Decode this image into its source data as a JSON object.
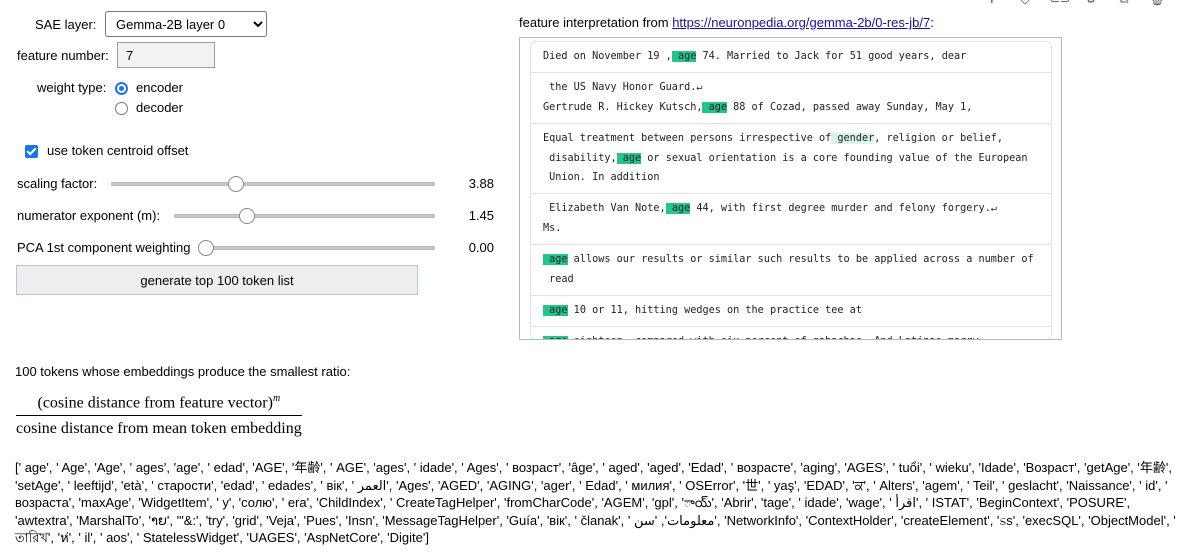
{
  "toolbar": {
    "icons": [
      "plus-icon",
      "diamond-icon",
      "link-icon",
      "gear-icon",
      "expand-icon",
      "trash-icon"
    ]
  },
  "controls": {
    "sae_layer_label": "SAE layer:",
    "sae_layer_value": "Gemma-2B layer 0",
    "feature_number_label": "feature number:",
    "feature_number_value": "7",
    "weight_type_label": "weight type:",
    "weight_options": [
      {
        "label": "encoder",
        "selected": true
      },
      {
        "label": "decoder",
        "selected": false
      }
    ],
    "centroid_label": "use token centroid offset",
    "centroid_checked": true,
    "sliders": [
      {
        "label": "scaling factor:",
        "value": "3.88",
        "fraction": 0.31
      },
      {
        "label": "numerator exponent (m):",
        "value": "1.45",
        "fraction": 0.28
      },
      {
        "label": "PCA 1st component weighting",
        "value": "0.00",
        "fraction": 0.0
      }
    ],
    "generate_button": "generate top 100 token list"
  },
  "interpretation": {
    "prefix": "feature interpretation from ",
    "link": "https://neuronpedia.org/gemma-2b/0-res-jb/7",
    "suffix": ":",
    "snippets": [
      {
        "parts": [
          {
            "t": "Died on November 19 ,"
          },
          {
            "t": " age",
            "h": 1
          },
          {
            "t": " 74. Married to Jack for 51 good years, dear"
          }
        ]
      },
      {
        "parts": [
          {
            "t": " the US Navy Honor Guard.↵\nGertrude R. Hickey Kutsch,"
          },
          {
            "t": " age",
            "h": 1
          },
          {
            "t": " 88 of Cozad, passed away Sunday, May 1,"
          }
        ]
      },
      {
        "parts": [
          {
            "t": "Equal treatment between persons irrespective of"
          },
          {
            "t": " gender",
            "h": 2
          },
          {
            "t": ", religion or belief,\n disability,"
          },
          {
            "t": " age",
            "h": 1
          },
          {
            "t": " or sexual orientation is a core founding value of the European\n Union. In addition"
          }
        ]
      },
      {
        "parts": [
          {
            "t": " Elizabeth Van Note,"
          },
          {
            "t": " age",
            "h": 1
          },
          {
            "t": " 44, with first degree murder and felony forgery.↵\nMs."
          }
        ]
      },
      {
        "parts": [
          {
            "t": " age",
            "h": 1
          },
          {
            "t": " allows our results or similar such results to be applied across a number of\n read"
          }
        ]
      },
      {
        "parts": [
          {
            "t": " age",
            "h": 1
          },
          {
            "t": " 10 or 11, hitting wedges on the practice tee at"
          }
        ]
      },
      {
        "parts": [
          {
            "t": " age",
            "h": 1
          },
          {
            "t": " eighteen, compared with six percent of gabachas. And Latinas marry"
          }
        ]
      }
    ]
  },
  "results": {
    "heading": "100 tokens whose embeddings produce the smallest ratio:",
    "formula_numerator": "(cosine distance from feature vector)",
    "formula_exponent": "m",
    "formula_denominator": "cosine distance from mean token embedding",
    "token_list": "[' age', ' Age', 'Age', ' ages', 'age', ' edad', 'AGE', '年齢', ' AGE', 'ages', ' idade', ' Ages', ' возраст', 'âge', ' aged', 'aged', 'Edad', ' возрасте', 'aging', 'AGES', ' tuổi', ' wieku', 'Idade', 'Возраст', 'getAge', '年齢', 'setAge', ' leeftijd', 'età', ' старости', 'edad', ' edades', ' вік', ' العمر', 'Ages', 'AGED', 'AGING', 'ager', ' Edad', ' милия', ' OSError', '世', ' yaş', 'EDAD', 'ਕ', ' Alters', 'agem', ' Teil', ' geslacht', 'Naissance', ' id', ' возраста', 'maxAge', 'WidgetItem', ' y', 'солю', ' era', 'ChildIndex', ' CreateTagHelper', 'fromCharCode', 'AGEM', 'gpl', 'ాయ్', 'Abrir', 'tage', ' idade', 'wage', ' اقرأ', ' ISTAT', 'BeginContext', 'POSURE', 'awtextra', 'MarshalTo', 'າຍ', '\"&:', 'try', 'grid', 'Veja', 'Pues', 'Insn', 'MessageTagHelper', 'Guía', 'вік', ' članak', ' معلومات', 'سن', 'NetworkInfo', 'ContextHolder', 'createElement', 'ಽs', 'execSQL', 'ObjectModel', ' তারিখ', 'ห่', ' il', ' aos', ' StatelessWidget', 'UAGES', 'AspNetCore', 'Digite']"
  }
}
